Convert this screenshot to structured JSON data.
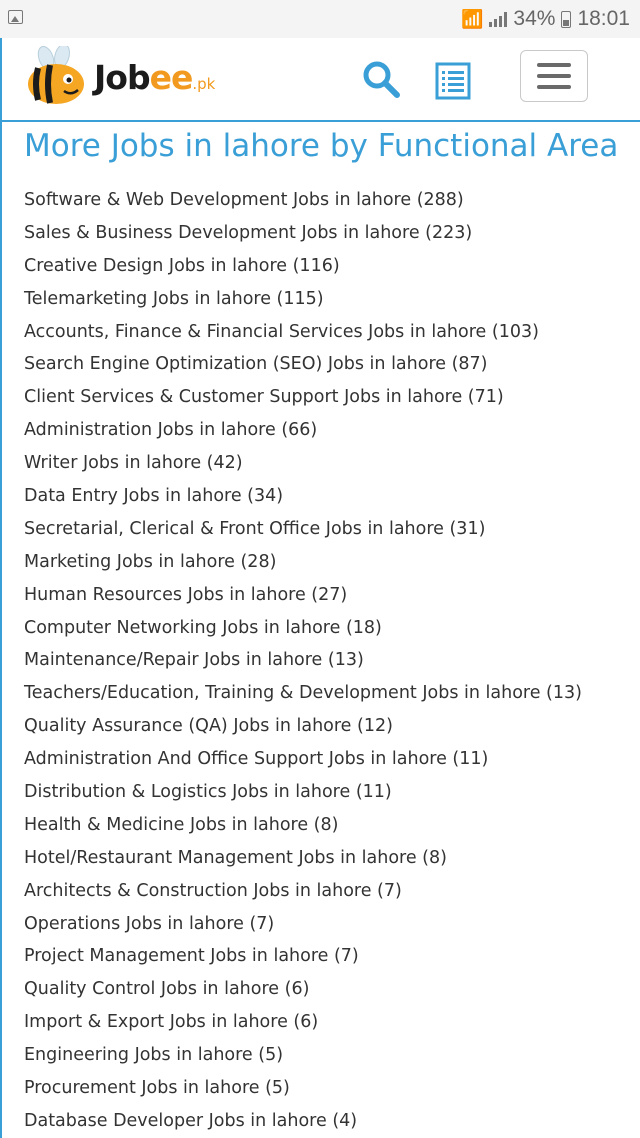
{
  "status_bar": {
    "battery": "34%",
    "time": "18:01",
    "icons": [
      "image-notification-icon",
      "wifi-icon",
      "signal-icon",
      "battery-icon"
    ]
  },
  "header": {
    "logo": {
      "text_main": "Job",
      "text_accent": "ee",
      "text_suffix": ".pk"
    },
    "colors": {
      "accent": "#3a9fd6",
      "logo_orange": "#f29a1f"
    },
    "icons": [
      "search-icon",
      "list-icon",
      "hamburger-menu-icon"
    ]
  },
  "main": {
    "title": "More Jobs in lahore by Functional Area",
    "jobs": [
      "Software & Web Development Jobs in lahore (288)",
      "Sales & Business Development Jobs in lahore (223)",
      "Creative Design Jobs in lahore (116)",
      "Telemarketing Jobs in lahore (115)",
      "Accounts, Finance & Financial Services Jobs in lahore (103)",
      "Search Engine Optimization (SEO) Jobs in lahore (87)",
      "Client Services & Customer Support Jobs in lahore (71)",
      "Administration Jobs in lahore (66)",
      "Writer Jobs in lahore (42)",
      "Data Entry Jobs in lahore (34)",
      "Secretarial, Clerical & Front Office Jobs in lahore (31)",
      "Marketing Jobs in lahore (28)",
      "Human Resources Jobs in lahore (27)",
      "Computer Networking Jobs in lahore (18)",
      "Maintenance/Repair Jobs in lahore (13)",
      "Teachers/Education, Training & Development Jobs in lahore (13)",
      "Quality Assurance (QA) Jobs in lahore (12)",
      "Administration And Office Support Jobs in lahore (11)",
      "Distribution & Logistics Jobs in lahore (11)",
      "Health & Medicine Jobs in lahore (8)",
      "Hotel/Restaurant Management Jobs in lahore (8)",
      "Architects & Construction Jobs in lahore (7)",
      "Operations Jobs in lahore (7)",
      "Project Management Jobs in lahore (7)",
      "Quality Control Jobs in lahore (6)",
      "Import & Export Jobs in lahore (6)",
      "Engineering Jobs in lahore (5)",
      "Procurement Jobs in lahore (5)",
      "Database Developer Jobs in lahore (4)"
    ]
  }
}
